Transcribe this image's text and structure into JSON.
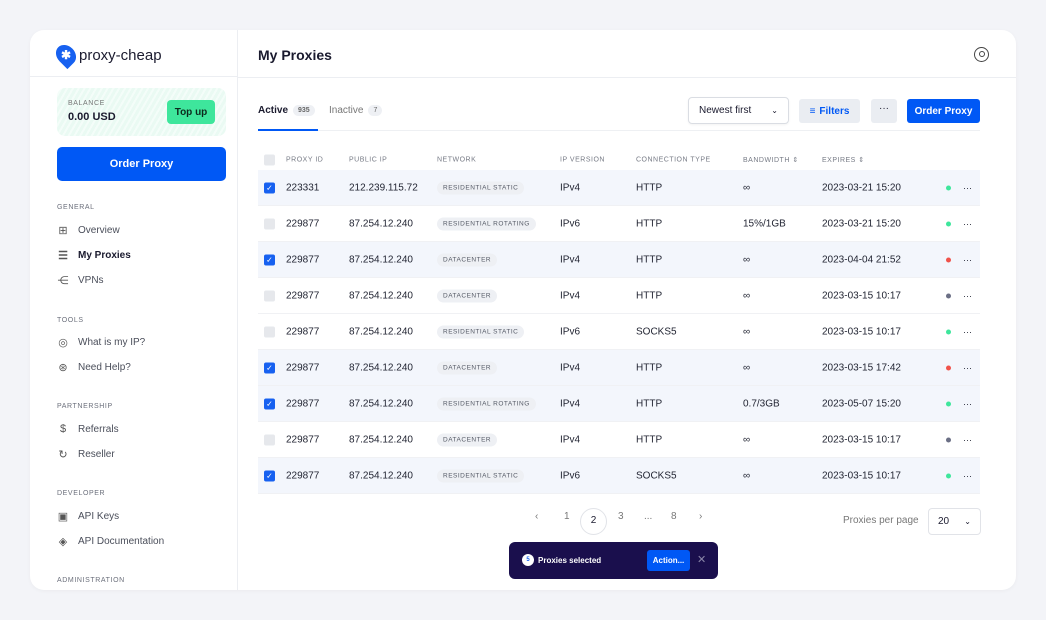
{
  "brand": "proxy-cheap",
  "balance": {
    "label": "BALANCE",
    "value": "0.00 USD",
    "topup": "Top up"
  },
  "sidebar": {
    "order": "Order Proxy",
    "sections": [
      {
        "title": "GENERAL",
        "items": [
          {
            "label": "Overview",
            "icon": "grid-icon"
          },
          {
            "label": "My Proxies",
            "icon": "server-icon",
            "active": true
          },
          {
            "label": "VPNs",
            "icon": "network-icon"
          }
        ]
      },
      {
        "title": "TOOLS",
        "items": [
          {
            "label": "What is my IP?",
            "icon": "location-icon"
          },
          {
            "label": "Need Help?",
            "icon": "lifebuoy-icon"
          }
        ]
      },
      {
        "title": "PARTNERSHIP",
        "items": [
          {
            "label": "Referrals",
            "icon": "dollar-icon"
          },
          {
            "label": "Reseller",
            "icon": "sync-icon"
          }
        ]
      },
      {
        "title": "DEVELOPER",
        "items": [
          {
            "label": "API Keys",
            "icon": "chip-icon"
          },
          {
            "label": "API Documentation",
            "icon": "layers-icon"
          }
        ]
      },
      {
        "title": "ADMINISTRATION",
        "items": []
      }
    ]
  },
  "header": {
    "title": "My Proxies"
  },
  "tabs": [
    {
      "label": "Active",
      "count": "935"
    },
    {
      "label": "Inactive",
      "count": "7"
    }
  ],
  "toolbar": {
    "sort": "Newest first",
    "filters": "Filters",
    "more": "···",
    "order": "Order Proxy"
  },
  "table": {
    "headers": [
      "PROXY ID",
      "PUBLIC IP",
      "NETWORK",
      "IP VERSION",
      "CONNECTION TYPE",
      "BANDWIDTH ⇕",
      "EXPIRES ⇕"
    ],
    "rows": [
      {
        "sel": true,
        "id": "223331",
        "ip": "212.239.115.72",
        "net": "RESIDENTIAL STATIC",
        "ver": "IPv4",
        "conn": "HTTP",
        "bw": "∞",
        "exp": "2023-03-21 15:20",
        "status": "#3ee69c"
      },
      {
        "sel": false,
        "id": "229877",
        "ip": "87.254.12.240",
        "net": "RESIDENTIAL ROTATING",
        "ver": "IPv6",
        "conn": "HTTP",
        "bw": "15%/1GB",
        "exp": "2023-03-21 15:20",
        "status": "#3ee69c"
      },
      {
        "sel": true,
        "id": "229877",
        "ip": "87.254.12.240",
        "net": "DATACENTER",
        "ver": "IPv4",
        "conn": "HTTP",
        "bw": "∞",
        "exp": "2023-04-04 21:52",
        "status": "#f0524a"
      },
      {
        "sel": false,
        "id": "229877",
        "ip": "87.254.12.240",
        "net": "DATACENTER",
        "ver": "IPv4",
        "conn": "HTTP",
        "bw": "∞",
        "exp": "2023-03-15 10:17",
        "status": "#6b6f85"
      },
      {
        "sel": false,
        "id": "229877",
        "ip": "87.254.12.240",
        "net": "RESIDENTIAL STATIC",
        "ver": "IPv6",
        "conn": "SOCKS5",
        "bw": "∞",
        "exp": "2023-03-15 10:17",
        "status": "#3ee69c"
      },
      {
        "sel": true,
        "id": "229877",
        "ip": "87.254.12.240",
        "net": "DATACENTER",
        "ver": "IPv4",
        "conn": "HTTP",
        "bw": "∞",
        "exp": "2023-03-15 17:42",
        "status": "#f0524a"
      },
      {
        "sel": true,
        "id": "229877",
        "ip": "87.254.12.240",
        "net": "RESIDENTIAL ROTATING",
        "ver": "IPv4",
        "conn": "HTTP",
        "bw": "0.7/3GB",
        "exp": "2023-05-07 15:20",
        "status": "#3ee69c"
      },
      {
        "sel": false,
        "id": "229877",
        "ip": "87.254.12.240",
        "net": "DATACENTER",
        "ver": "IPv4",
        "conn": "HTTP",
        "bw": "∞",
        "exp": "2023-03-15 10:17",
        "status": "#6b6f85"
      },
      {
        "sel": true,
        "id": "229877",
        "ip": "87.254.12.240",
        "net": "RESIDENTIAL STATIC",
        "ver": "IPv6",
        "conn": "SOCKS5",
        "bw": "∞",
        "exp": "2023-03-15 10:17",
        "status": "#3ee69c"
      }
    ]
  },
  "pagination": {
    "prev": "‹",
    "pages": [
      "1",
      "2",
      "3",
      "...",
      "8"
    ],
    "current": "2",
    "next": "›",
    "per_page_label": "Proxies per page",
    "per_page": "20"
  },
  "toast": {
    "count": "5",
    "label": "Proxies selected",
    "action": "Action...",
    "close": "✕"
  }
}
